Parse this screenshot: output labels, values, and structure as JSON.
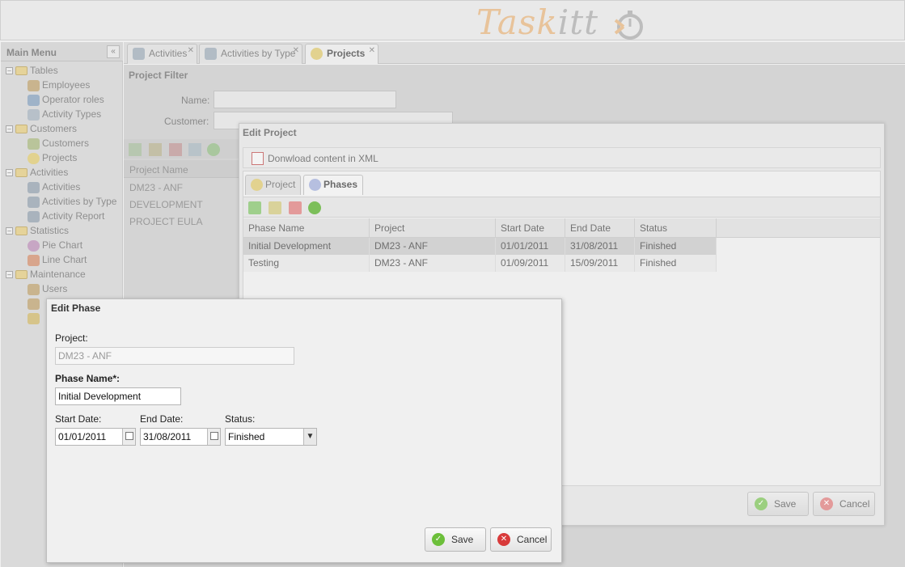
{
  "app": {
    "logo_part1": "Task",
    "logo_part2": "itt"
  },
  "sidebar": {
    "title": "Main Menu",
    "collapse_icon": "double-chevron-left",
    "items": [
      {
        "label": "Tables",
        "level": 0
      },
      {
        "label": "Employees",
        "level": 1
      },
      {
        "label": "Operator roles",
        "level": 1
      },
      {
        "label": "Activity Types",
        "level": 1
      },
      {
        "label": "Customers",
        "level": 0
      },
      {
        "label": "Customers",
        "level": 1
      },
      {
        "label": "Projects",
        "level": 1
      },
      {
        "label": "Activities",
        "level": 0
      },
      {
        "label": "Activities",
        "level": 1
      },
      {
        "label": "Activities by Type",
        "level": 1
      },
      {
        "label": "Activity Report",
        "level": 1
      },
      {
        "label": "Statistics",
        "level": 0
      },
      {
        "label": "Pie Chart",
        "level": 1
      },
      {
        "label": "Line Chart",
        "level": 1
      },
      {
        "label": "Maintenance",
        "level": 0
      },
      {
        "label": "Users",
        "level": 1
      }
    ]
  },
  "tabs": [
    {
      "label": "Activities",
      "active": false
    },
    {
      "label": "Activities by Type",
      "active": false
    },
    {
      "label": "Projects",
      "active": true
    }
  ],
  "project_filter": {
    "title": "Project Filter",
    "name_label": "Name:",
    "customer_label": "Customer:",
    "column_header": "Project Name",
    "rows": [
      "DM23 - ANF",
      "DEVELOPMENT",
      "PROJECT EULA"
    ]
  },
  "edit_project": {
    "title": "Edit Project",
    "download_label": "Donwload content in XML",
    "tabs": [
      "Project",
      "Phases"
    ],
    "columns": [
      "Phase Name",
      "Project",
      "Start Date",
      "End Date",
      "Status"
    ],
    "rows": [
      [
        "Initial Development",
        "DM23 - ANF",
        "01/01/2011",
        "31/08/2011",
        "Finished"
      ],
      [
        "Testing",
        "DM23 - ANF",
        "01/09/2011",
        "15/09/2011",
        "Finished"
      ]
    ],
    "save_label": "Save",
    "cancel_label": "Cancel"
  },
  "edit_phase": {
    "title": "Edit Phase",
    "project_label": "Project:",
    "project_value": "DM23 - ANF",
    "phase_name_label": "Phase Name*:",
    "phase_name_value": "Initial Development",
    "start_date_label": "Start Date:",
    "start_date_value": "01/01/2011",
    "end_date_label": "End Date:",
    "end_date_value": "31/08/2011",
    "status_label": "Status:",
    "status_value": "Finished",
    "save_label": "Save",
    "cancel_label": "Cancel"
  },
  "colors": {
    "save_icon": "#6cbf3a",
    "cancel_icon": "#d83a3a",
    "logo_accent": "#e8c39a"
  }
}
